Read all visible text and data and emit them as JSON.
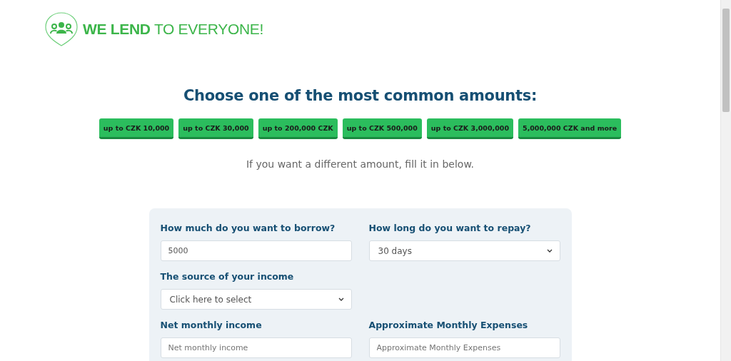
{
  "logo": {
    "text": "**WE LEND** TO EVERYONE!"
  },
  "heading": "Choose one of the most common amounts:",
  "amount_buttons": [
    "up to CZK 10,000",
    "up to CZK 30,000",
    "up to 200,000 CZK",
    "up to CZK 500,000",
    "up to CZK 3,000,000",
    "5,000,000 CZK and more"
  ],
  "hint": "If you want a different amount, fill it in below.",
  "form": {
    "fields": [
      {
        "label": "How much do you want to borrow?",
        "kind": "input",
        "value": "5000"
      },
      {
        "label": "How long do you want to repay?",
        "kind": "select",
        "value": "30 days"
      },
      {
        "label": "The source of your income",
        "kind": "select",
        "value": "Click here to select"
      },
      {
        "kind": "empty"
      },
      {
        "label": "Net monthly income",
        "kind": "input",
        "placeholder": "Net monthly income"
      },
      {
        "label": "Approximate Monthly Expenses",
        "kind": "input",
        "placeholder": "Approximate Monthly Expenses"
      }
    ]
  }
}
